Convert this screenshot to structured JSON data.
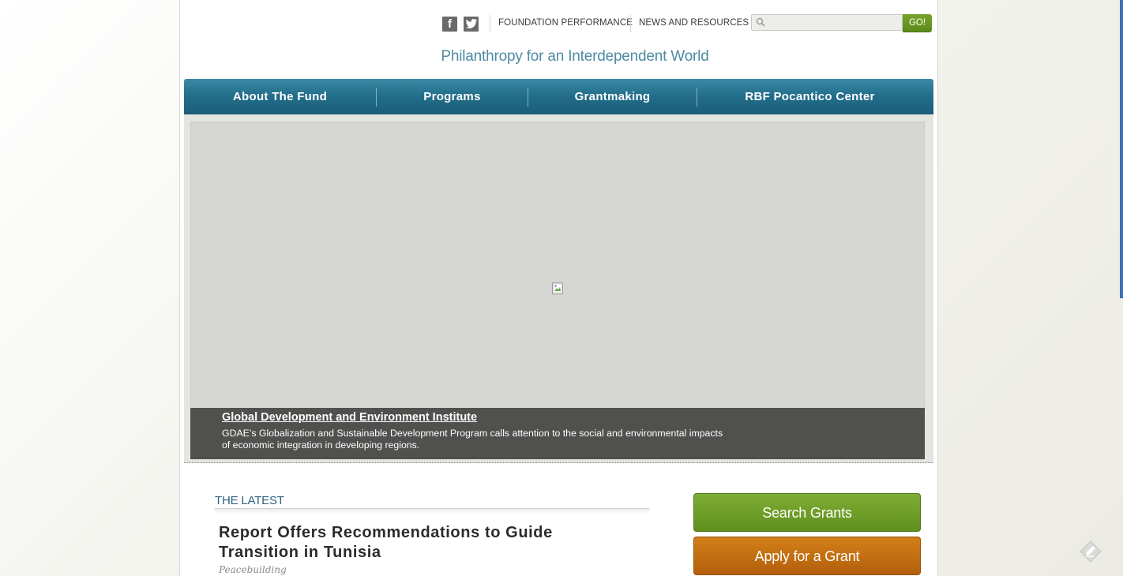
{
  "social": {
    "facebook_glyph": "f",
    "twitter_icon": "twitter-icon"
  },
  "utility_nav": {
    "performance": "FOUNDATION PERFORMANCE",
    "news": "NEWS AND RESOURCES"
  },
  "search": {
    "placeholder": "",
    "value": "",
    "button_label": "GO!"
  },
  "tagline": "Philanthropy for an Interdependent World",
  "main_nav": [
    {
      "label": "About The Fund"
    },
    {
      "label": "Programs"
    },
    {
      "label": "Grantmaking"
    },
    {
      "label": "RBF Pocantico Center"
    }
  ],
  "hero": {
    "caption_title": "Global Development and Environment Institute",
    "caption_text": "GDAE’s Globalization and Sustainable Development Program calls attention to the social and environmental impacts of economic integration in developing regions."
  },
  "latest": {
    "heading": "THE LATEST",
    "story_title": "Report Offers Recommendations to Guide Transition in Tunisia",
    "story_category": "Peacebuilding"
  },
  "cta": {
    "search_grants": "Search Grants",
    "apply": "Apply for a Grant"
  },
  "colors": {
    "nav_blue": "#236f8c",
    "tagline_blue": "#4f8ba2",
    "green_button": "#6a9a24",
    "orange_button": "#c56f12"
  }
}
